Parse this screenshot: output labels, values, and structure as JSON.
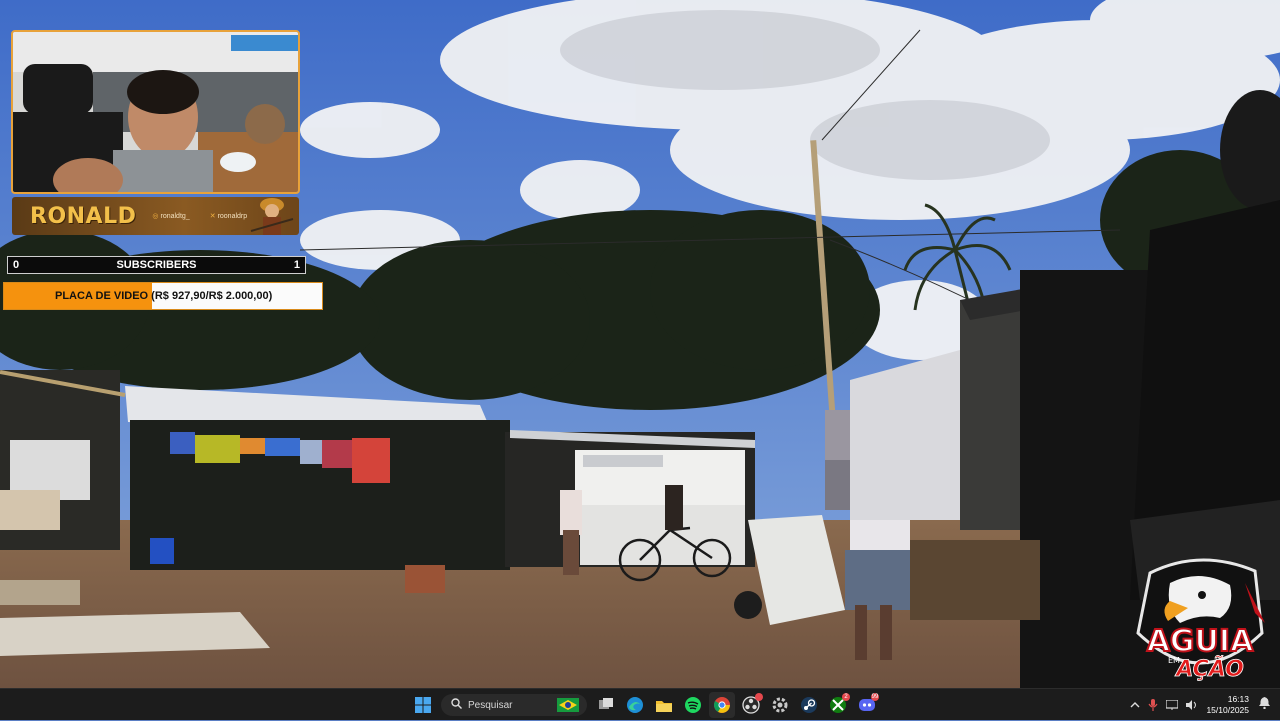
{
  "overlay": {
    "streamer_name": "RONALD",
    "handle_1_icon": "instagram-icon",
    "handle_1": "ronaldtg_",
    "handle_2_icon": "x-icon",
    "handle_2": "roonaldrp",
    "subscribers": {
      "left": "0",
      "label": "SUBSCRIBERS",
      "right": "1"
    },
    "goal": {
      "label": "PLACA DE VIDEO",
      "amount": "(R$ 927,90/R$ 2.000,00)",
      "current": 927.9,
      "target": 2000.0
    },
    "logo": {
      "line1": "AGUIA",
      "small": "EM",
      "line2": "AÇÃO"
    }
  },
  "taskbar": {
    "search_placeholder": "Pesquisar",
    "apps": [
      "windows-start",
      "search",
      "task-view",
      "edge",
      "file-explorer",
      "spotify",
      "chrome",
      "obs-studio",
      "settings",
      "steam",
      "xbox",
      "discord"
    ],
    "xbox_badge": "2",
    "discord_badge": "99",
    "clock_time": "16:13",
    "clock_date": "15/10/2025"
  },
  "colors": {
    "accent_orange": "#f5920e",
    "taskbar": "#1c1c1c",
    "name_gold": "#f3c04a"
  }
}
